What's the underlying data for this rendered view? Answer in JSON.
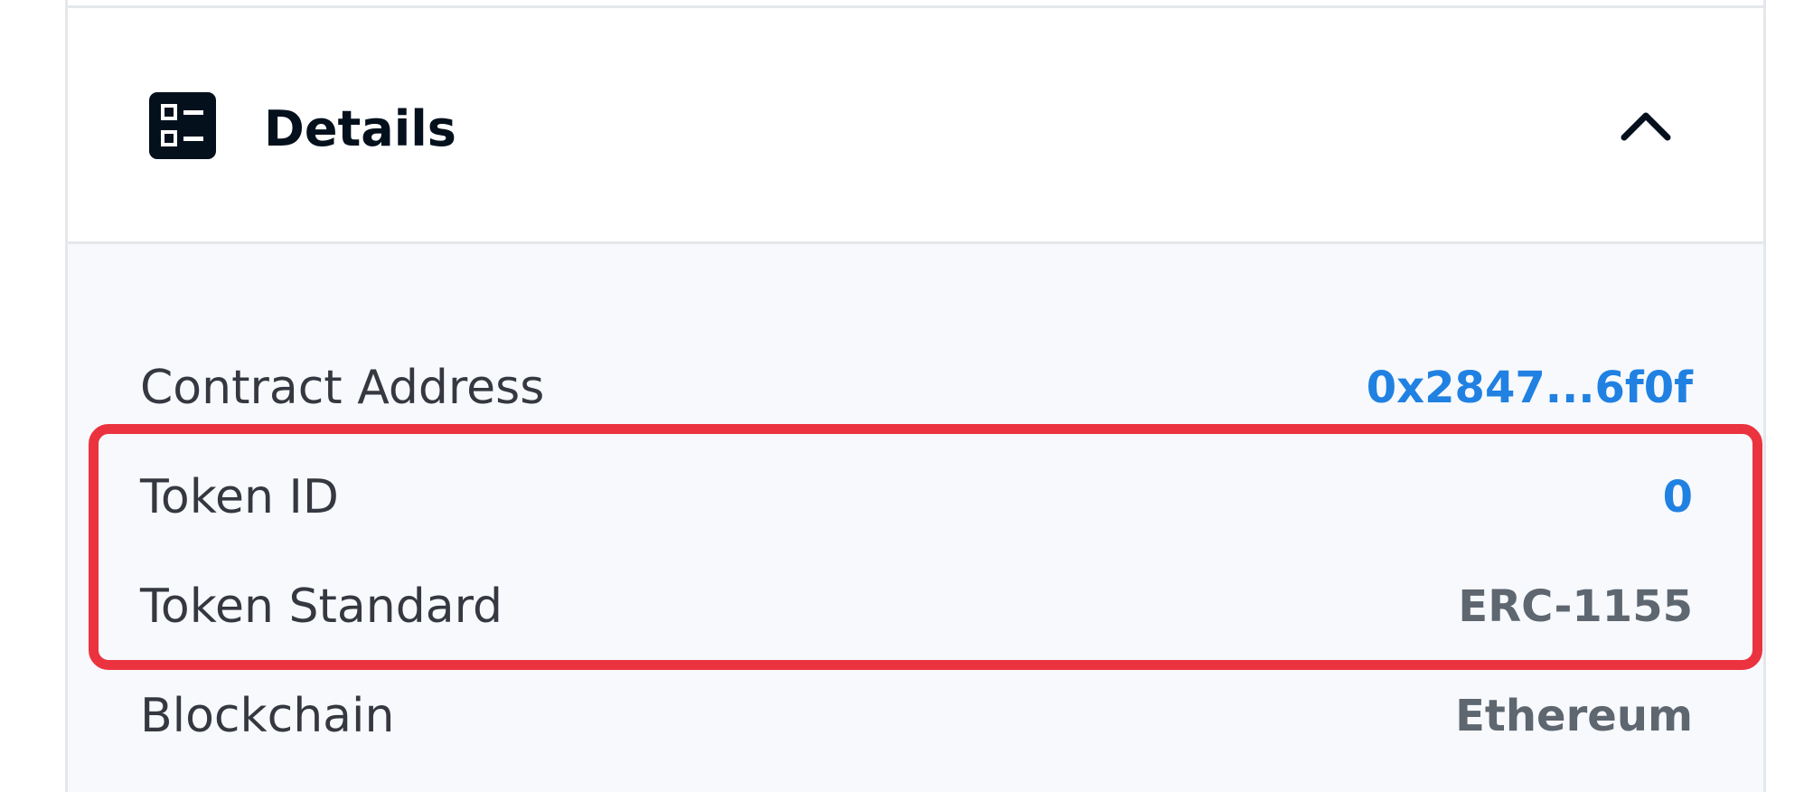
{
  "details": {
    "title": "Details",
    "rows": [
      {
        "label": "Contract Address",
        "value": "0x2847...6f0f",
        "link": true
      },
      {
        "label": "Token ID",
        "value": "0",
        "link": true
      },
      {
        "label": "Token Standard",
        "value": "ERC-1155",
        "link": false
      },
      {
        "label": "Blockchain",
        "value": "Ethereum",
        "link": false
      }
    ]
  },
  "colors": {
    "link": "#2081e2",
    "highlight": "#eb3340",
    "text": "#353840",
    "muted": "#5e6670"
  },
  "icons": {
    "header": "details-list-icon",
    "toggle": "chevron-up-icon"
  }
}
